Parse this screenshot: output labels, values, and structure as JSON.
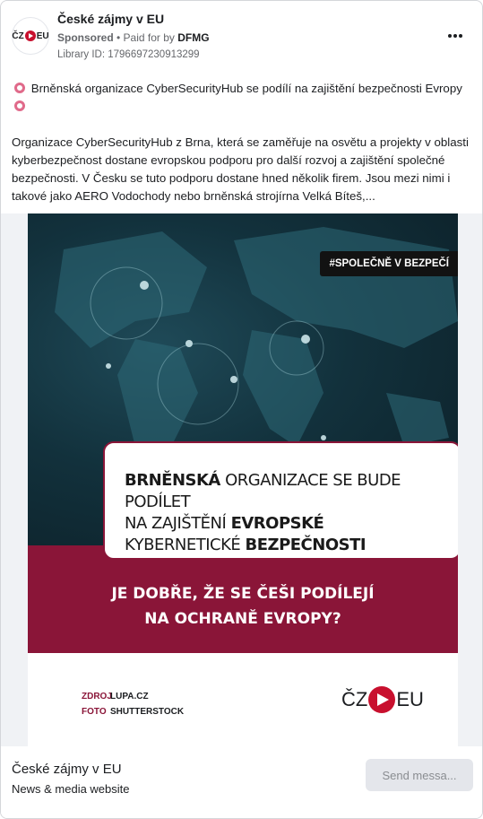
{
  "header": {
    "page_name": "České zájmy v EU",
    "sponsored": "Sponsored",
    "paid_for_prefix": "• Paid for by",
    "paid_for_by": "DFMG",
    "library_id": "Library ID: 1796697230913299",
    "avatar_text_left": "ČZ",
    "avatar_text_right": "EU",
    "more_icon": "more-horizontal-icon"
  },
  "post": {
    "line1": "Brněnská organizace CyberSecurityHub se podílí na zajištění bezpečnosti Evropy",
    "line2": "Organizace CyberSecurityHub z Brna, která se zaměřuje na osvětu a projekty v oblasti kyberbezpečnost dostane evropskou podporu pro další rozvoj a zajištění společné bezpečnosti. V Česku se tuto podporu dostane hned několik firem. Jsou mezi nimi i takové jako AERO Vodochody nebo brněnská strojírna Velká Bíteš,..."
  },
  "creative": {
    "hashtag": "#SPOLEČNĚ V BEZPEČÍ",
    "headline": [
      {
        "bold": "BRNĚNSKÁ",
        "rest": " ORGANIZACE SE BUDE PODÍLET"
      },
      {
        "bold": "",
        "rest": "NA ZAJIŠTĚNÍ ",
        "bold2": "EVROPSKÉ"
      },
      {
        "bold": "",
        "rest": "KYBERNETICKÉ ",
        "bold2": "BEZPEČNOSTI"
      }
    ],
    "slogan_1": "JE DOBŘE, ŽE SE ČEŠI PODÍLEJÍ",
    "slogan_2": "NA OCHRANĚ EVROPY?",
    "credit_source_key": "ZDROJ",
    "credit_source_val": "LUPA.CZ",
    "credit_photo_key": "FOTO",
    "credit_photo_val": "SHUTTERSTOCK",
    "logo_left": "ČZ",
    "logo_right": "EU",
    "colors": {
      "maroon": "#8a1538",
      "brand_red": "#c8102e",
      "map_dark": "#0c1f27"
    }
  },
  "footer": {
    "title": "České zájmy v EU",
    "subtitle": "News & media website",
    "send_button": "Send messa..."
  }
}
